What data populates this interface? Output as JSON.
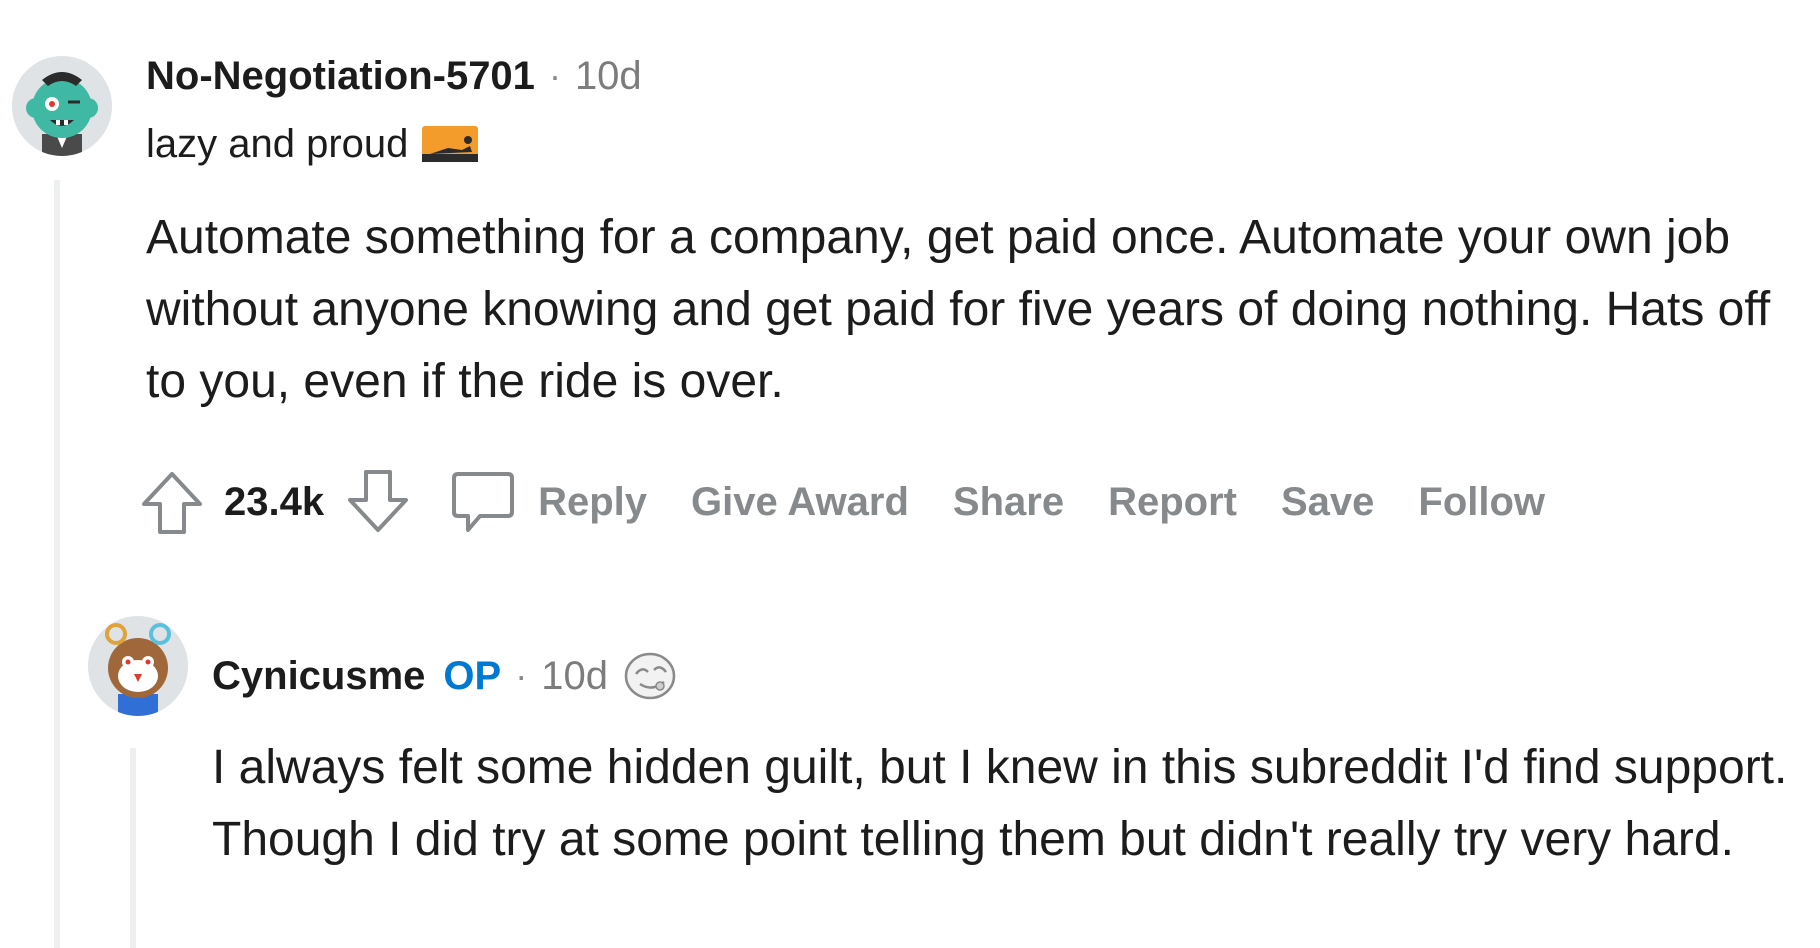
{
  "comment1": {
    "username": "No-Negotiation-5701",
    "separator": "·",
    "time": "10d",
    "flair_text": "lazy and proud",
    "flair_emoji": "sunbathing-emoji",
    "body": "Automate something for a company, get paid once. Automate your own job without anyone knowing and get paid for five years of doing nothing. Hats off to you, even if the ride is over.",
    "score": "23.4k",
    "actions": {
      "reply": "Reply",
      "give_award": "Give Award",
      "share": "Share",
      "report": "Report",
      "save": "Save",
      "follow": "Follow"
    }
  },
  "comment2": {
    "username": "Cynicusme",
    "op_badge": "OP",
    "separator": "·",
    "time": "10d",
    "award_icon": "silver-award-icon",
    "body": "I always felt some hidden guilt, but I knew in this subreddit I'd find support. Though I did try at some point telling them but didn't really try very hard."
  },
  "colors": {
    "username": "#1c1c1c",
    "meta": "#7c7c7c",
    "action": "#878a8c",
    "op": "#0079d3",
    "thread_line": "#edeff1"
  }
}
